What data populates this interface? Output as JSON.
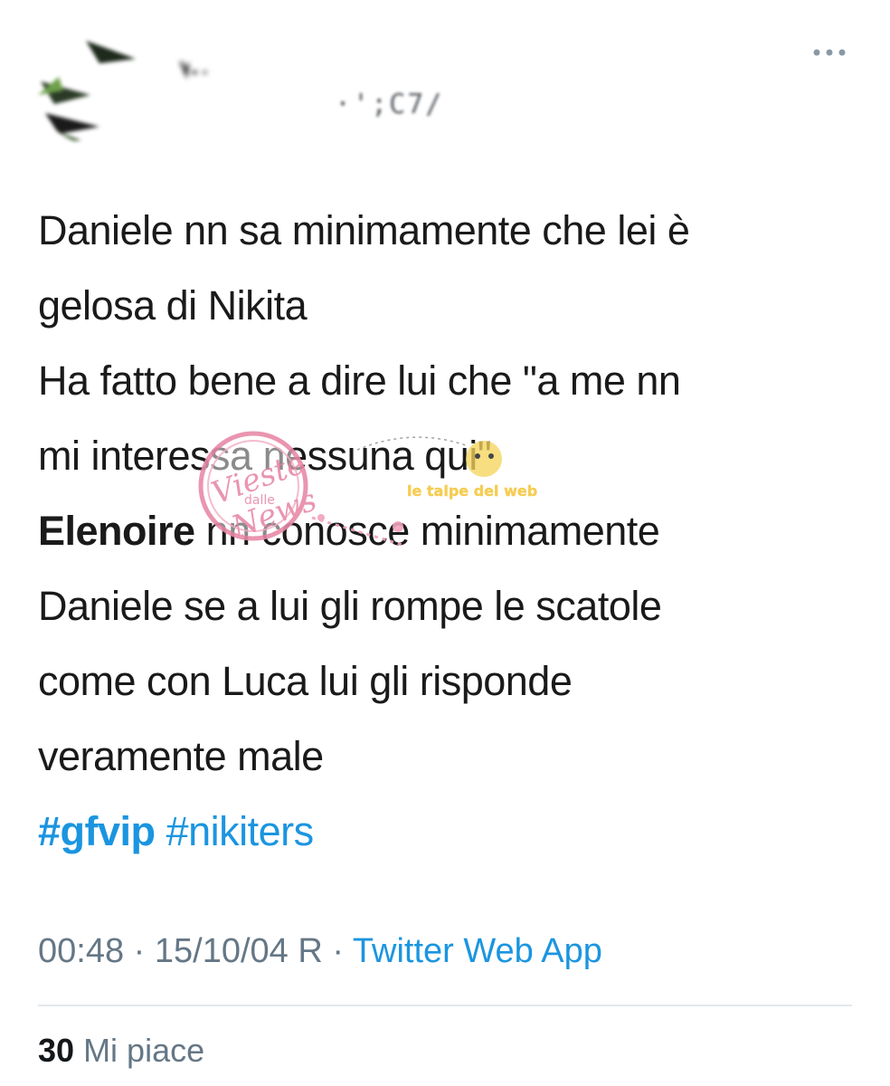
{
  "tweet": {
    "handle_fragment": "·';C7/",
    "menu_icon": "more-dots-icon",
    "body": {
      "line1": "Daniele nn sa minimamente che lei è",
      "line2": "gelosa di Nikita",
      "line3": "Ha fatto bene a dire lui che \"a me nn",
      "line4": "mi interessa nessuna qui\"",
      "mention_bold": "Elenoire",
      "line5_rest": " nn conosce minimamente",
      "line6": "Daniele se a lui gli rompe le scatole",
      "line7": "come con Luca lui gli risponde",
      "line8": "veramente male"
    },
    "hashtags": [
      "#gfvip",
      "#nikiters"
    ],
    "meta": {
      "time": "00:48",
      "separator": " · ",
      "date": "15/10/04 R",
      "source": "Twitter Web App"
    },
    "likes": {
      "count": "30",
      "label": "Mi piace"
    }
  },
  "watermark": {
    "logo_text": "Vieste dalle News",
    "tagline": "le talpe del web"
  },
  "colors": {
    "link": "#1b95e0",
    "meta": "#657786",
    "divider": "#e1e8ed",
    "watermark_pink": "#e88aa8",
    "watermark_yellow": "#f5d35a"
  }
}
